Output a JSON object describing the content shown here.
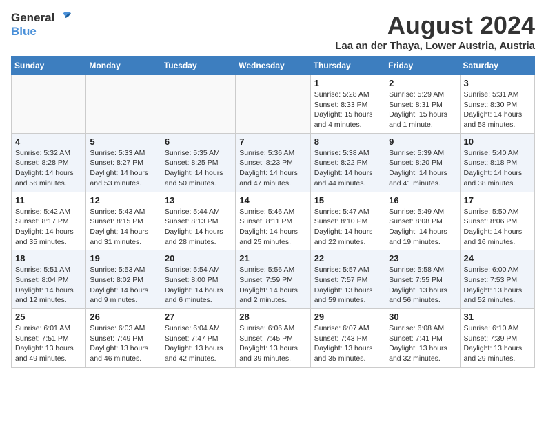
{
  "header": {
    "logo_general": "General",
    "logo_blue": "Blue",
    "month_year": "August 2024",
    "location": "Laa an der Thaya, Lower Austria, Austria"
  },
  "weekdays": [
    "Sunday",
    "Monday",
    "Tuesday",
    "Wednesday",
    "Thursday",
    "Friday",
    "Saturday"
  ],
  "weeks": [
    [
      {
        "day": "",
        "info": ""
      },
      {
        "day": "",
        "info": ""
      },
      {
        "day": "",
        "info": ""
      },
      {
        "day": "",
        "info": ""
      },
      {
        "day": "1",
        "info": "Sunrise: 5:28 AM\nSunset: 8:33 PM\nDaylight: 15 hours\nand 4 minutes."
      },
      {
        "day": "2",
        "info": "Sunrise: 5:29 AM\nSunset: 8:31 PM\nDaylight: 15 hours\nand 1 minute."
      },
      {
        "day": "3",
        "info": "Sunrise: 5:31 AM\nSunset: 8:30 PM\nDaylight: 14 hours\nand 58 minutes."
      }
    ],
    [
      {
        "day": "4",
        "info": "Sunrise: 5:32 AM\nSunset: 8:28 PM\nDaylight: 14 hours\nand 56 minutes."
      },
      {
        "day": "5",
        "info": "Sunrise: 5:33 AM\nSunset: 8:27 PM\nDaylight: 14 hours\nand 53 minutes."
      },
      {
        "day": "6",
        "info": "Sunrise: 5:35 AM\nSunset: 8:25 PM\nDaylight: 14 hours\nand 50 minutes."
      },
      {
        "day": "7",
        "info": "Sunrise: 5:36 AM\nSunset: 8:23 PM\nDaylight: 14 hours\nand 47 minutes."
      },
      {
        "day": "8",
        "info": "Sunrise: 5:38 AM\nSunset: 8:22 PM\nDaylight: 14 hours\nand 44 minutes."
      },
      {
        "day": "9",
        "info": "Sunrise: 5:39 AM\nSunset: 8:20 PM\nDaylight: 14 hours\nand 41 minutes."
      },
      {
        "day": "10",
        "info": "Sunrise: 5:40 AM\nSunset: 8:18 PM\nDaylight: 14 hours\nand 38 minutes."
      }
    ],
    [
      {
        "day": "11",
        "info": "Sunrise: 5:42 AM\nSunset: 8:17 PM\nDaylight: 14 hours\nand 35 minutes."
      },
      {
        "day": "12",
        "info": "Sunrise: 5:43 AM\nSunset: 8:15 PM\nDaylight: 14 hours\nand 31 minutes."
      },
      {
        "day": "13",
        "info": "Sunrise: 5:44 AM\nSunset: 8:13 PM\nDaylight: 14 hours\nand 28 minutes."
      },
      {
        "day": "14",
        "info": "Sunrise: 5:46 AM\nSunset: 8:11 PM\nDaylight: 14 hours\nand 25 minutes."
      },
      {
        "day": "15",
        "info": "Sunrise: 5:47 AM\nSunset: 8:10 PM\nDaylight: 14 hours\nand 22 minutes."
      },
      {
        "day": "16",
        "info": "Sunrise: 5:49 AM\nSunset: 8:08 PM\nDaylight: 14 hours\nand 19 minutes."
      },
      {
        "day": "17",
        "info": "Sunrise: 5:50 AM\nSunset: 8:06 PM\nDaylight: 14 hours\nand 16 minutes."
      }
    ],
    [
      {
        "day": "18",
        "info": "Sunrise: 5:51 AM\nSunset: 8:04 PM\nDaylight: 14 hours\nand 12 minutes."
      },
      {
        "day": "19",
        "info": "Sunrise: 5:53 AM\nSunset: 8:02 PM\nDaylight: 14 hours\nand 9 minutes."
      },
      {
        "day": "20",
        "info": "Sunrise: 5:54 AM\nSunset: 8:00 PM\nDaylight: 14 hours\nand 6 minutes."
      },
      {
        "day": "21",
        "info": "Sunrise: 5:56 AM\nSunset: 7:59 PM\nDaylight: 14 hours\nand 2 minutes."
      },
      {
        "day": "22",
        "info": "Sunrise: 5:57 AM\nSunset: 7:57 PM\nDaylight: 13 hours\nand 59 minutes."
      },
      {
        "day": "23",
        "info": "Sunrise: 5:58 AM\nSunset: 7:55 PM\nDaylight: 13 hours\nand 56 minutes."
      },
      {
        "day": "24",
        "info": "Sunrise: 6:00 AM\nSunset: 7:53 PM\nDaylight: 13 hours\nand 52 minutes."
      }
    ],
    [
      {
        "day": "25",
        "info": "Sunrise: 6:01 AM\nSunset: 7:51 PM\nDaylight: 13 hours\nand 49 minutes."
      },
      {
        "day": "26",
        "info": "Sunrise: 6:03 AM\nSunset: 7:49 PM\nDaylight: 13 hours\nand 46 minutes."
      },
      {
        "day": "27",
        "info": "Sunrise: 6:04 AM\nSunset: 7:47 PM\nDaylight: 13 hours\nand 42 minutes."
      },
      {
        "day": "28",
        "info": "Sunrise: 6:06 AM\nSunset: 7:45 PM\nDaylight: 13 hours\nand 39 minutes."
      },
      {
        "day": "29",
        "info": "Sunrise: 6:07 AM\nSunset: 7:43 PM\nDaylight: 13 hours\nand 35 minutes."
      },
      {
        "day": "30",
        "info": "Sunrise: 6:08 AM\nSunset: 7:41 PM\nDaylight: 13 hours\nand 32 minutes."
      },
      {
        "day": "31",
        "info": "Sunrise: 6:10 AM\nSunset: 7:39 PM\nDaylight: 13 hours\nand 29 minutes."
      }
    ]
  ]
}
